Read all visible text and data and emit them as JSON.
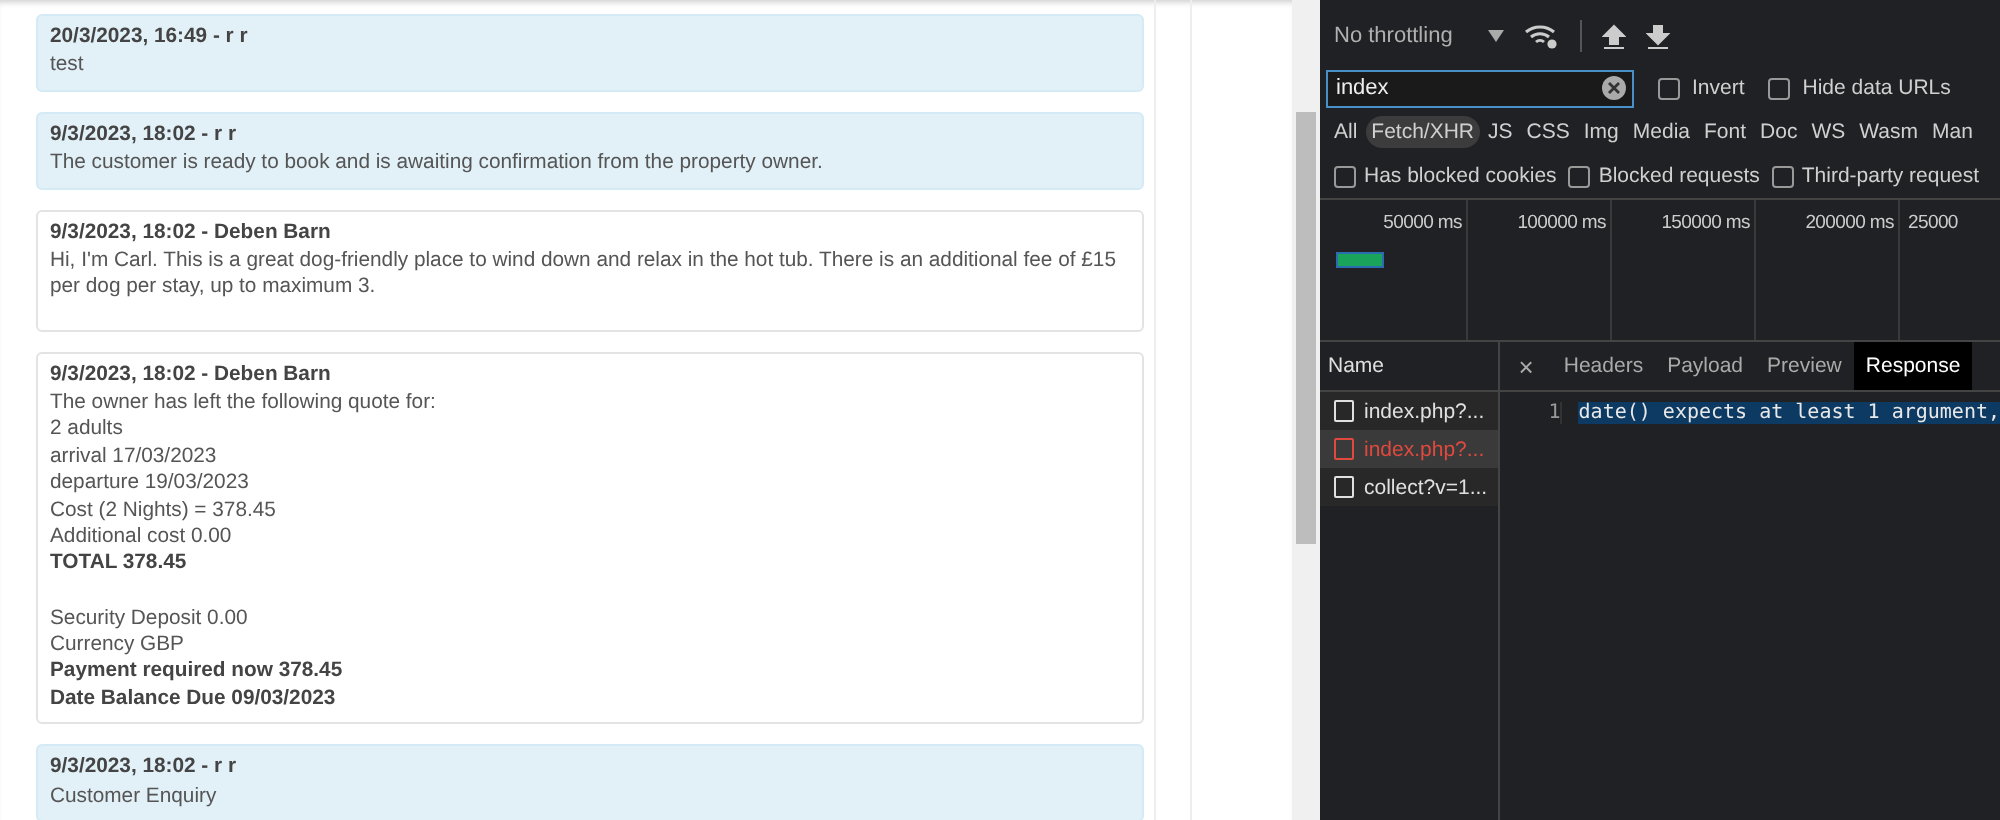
{
  "messages": [
    {
      "kind": "customer",
      "header": "20/3/2023, 16:49 - r r",
      "lines": [
        {
          "text": "test",
          "bold": false
        }
      ]
    },
    {
      "kind": "customer",
      "header": "9/3/2023, 18:02 - r r",
      "lines": [
        {
          "text": "The customer is ready to book and is awaiting confirmation from the property owner.",
          "bold": false
        }
      ]
    },
    {
      "kind": "owner",
      "header": "9/3/2023, 18:02 - Deben Barn",
      "lines": [
        {
          "text": "Hi, I'm Carl. This is a great dog-friendly place to wind down and relax in the hot tub. There is an additional fee of £15 per dog per stay, up to maximum 3.",
          "bold": false
        }
      ]
    },
    {
      "kind": "owner",
      "header": "9/3/2023, 18:02 - Deben Barn",
      "lines": [
        {
          "text": "The owner has left the following quote for:",
          "bold": false
        },
        {
          "text": "2 adults",
          "bold": false
        },
        {
          "text": "arrival 17/03/2023",
          "bold": false
        },
        {
          "text": "departure 19/03/2023",
          "bold": false
        },
        {
          "text": "Cost (2 Nights) = 378.45",
          "bold": false
        },
        {
          "text": "Additional cost 0.00",
          "bold": false
        },
        {
          "text": "TOTAL 378.45",
          "bold": true
        },
        {
          "text": "Security Deposit 0.00",
          "bold": false,
          "gap_before": true
        },
        {
          "text": "Currency GBP",
          "bold": false
        },
        {
          "text": "Payment required now 378.45",
          "bold": true
        },
        {
          "text": "Date Balance Due 09/03/2023",
          "bold": true
        }
      ]
    },
    {
      "kind": "customer",
      "header": "9/3/2023, 18:02 - r r",
      "lines": [
        {
          "text": "Customer Enquiry",
          "bold": false
        }
      ]
    }
  ],
  "devtools": {
    "throttling": "No throttling",
    "filter": {
      "value": "index"
    },
    "filter_options": [
      {
        "label": "Invert",
        "checked": false
      },
      {
        "label": "Hide data URLs",
        "checked": false
      }
    ],
    "type_filters": [
      {
        "label": "All",
        "selected": false
      },
      {
        "label": "Fetch/XHR",
        "selected": true
      },
      {
        "label": "JS",
        "selected": false
      },
      {
        "label": "CSS",
        "selected": false
      },
      {
        "label": "Img",
        "selected": false
      },
      {
        "label": "Media",
        "selected": false
      },
      {
        "label": "Font",
        "selected": false
      },
      {
        "label": "Doc",
        "selected": false
      },
      {
        "label": "WS",
        "selected": false
      },
      {
        "label": "Wasm",
        "selected": false
      },
      {
        "label": "Man",
        "selected": false
      }
    ],
    "request_options": [
      {
        "label": "Has blocked cookies",
        "checked": false
      },
      {
        "label": "Blocked requests",
        "checked": false
      },
      {
        "label": "Third-party request",
        "checked": false
      }
    ],
    "timeline_ticks": [
      "50000 ms",
      "100000 ms",
      "150000 ms",
      "200000 ms",
      "25000"
    ],
    "name_header": "Name",
    "requests": [
      {
        "name": "index.php?...",
        "error": false,
        "selected": false
      },
      {
        "name": "index.php?...",
        "error": true,
        "selected": true
      },
      {
        "name": "collect?v=1...",
        "error": false,
        "selected": false
      }
    ],
    "close": "×",
    "tabs": [
      {
        "label": "Headers",
        "selected": false
      },
      {
        "label": "Payload",
        "selected": false
      },
      {
        "label": "Preview",
        "selected": false
      },
      {
        "label": "Response",
        "selected": true
      }
    ],
    "response_lines": [
      {
        "number": "1",
        "code": "date() expects at least 1 argument,"
      }
    ]
  }
}
